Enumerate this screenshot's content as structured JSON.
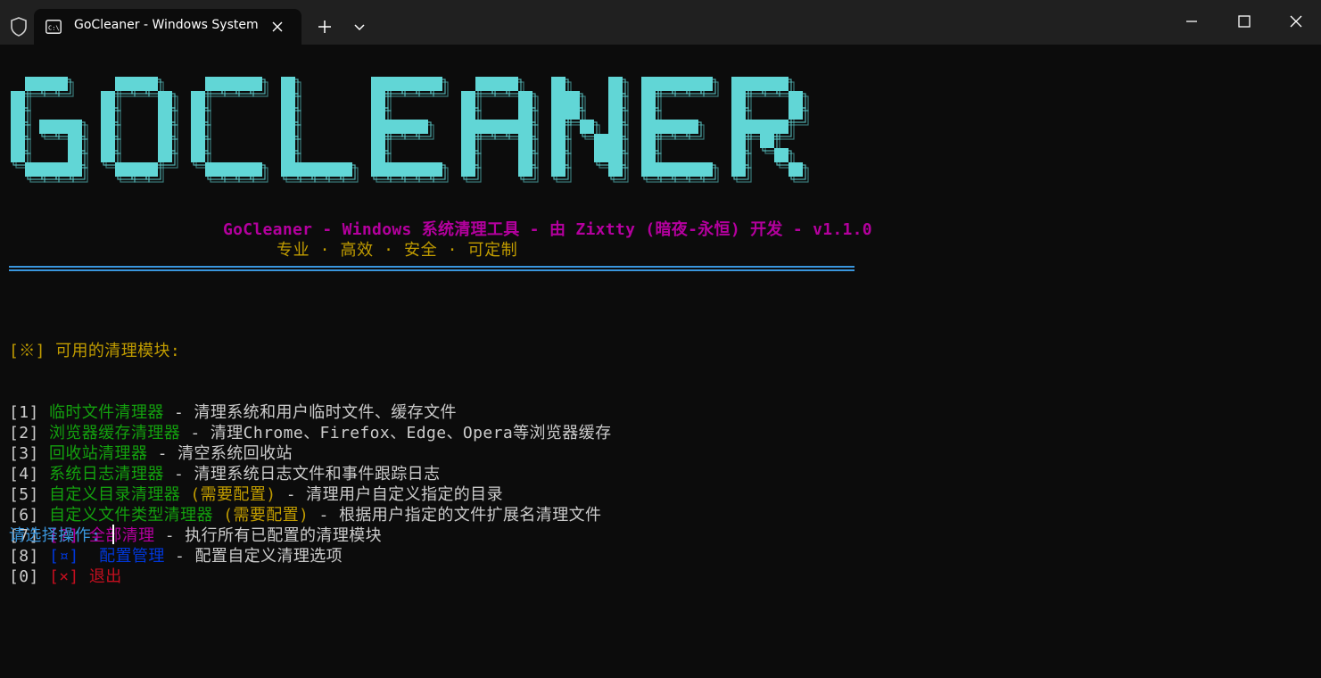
{
  "window": {
    "tab_title": "GoCleaner - Windows System"
  },
  "banner": {
    "text": "GOCLEANER",
    "color_main": "#61d6d6",
    "color_outline": "#61d6d6"
  },
  "header": {
    "subtitle": "GoCleaner - Windows 系统清理工具 - 由 Zixtty (暗夜-永恒) 开发 - v1.1.0",
    "slogan": "专业 · 高效 · 安全 · 可定制"
  },
  "menu": {
    "title": "[※] 可用的清理模块:",
    "items": [
      {
        "key": "[1] ",
        "name": "临时文件清理器",
        "extra": "",
        "desc": " - 清理系统和用户临时文件、缓存文件"
      },
      {
        "key": "[2] ",
        "name": "浏览器缓存清理器",
        "extra": "",
        "desc": " - 清理Chrome、Firefox、Edge、Opera等浏览器缓存"
      },
      {
        "key": "[3] ",
        "name": "回收站清理器",
        "extra": "",
        "desc": " - 清空系统回收站"
      },
      {
        "key": "[4] ",
        "name": "系统日志清理器",
        "extra": "",
        "desc": " - 清理系统日志文件和事件跟踪日志"
      },
      {
        "key": "[5] ",
        "name": "自定义目录清理器 ",
        "extra": "(需要配置)",
        "desc": " - 清理用户自定义指定的目录"
      },
      {
        "key": "[6] ",
        "name": "自定义文件类型清理器 ",
        "extra": "(需要配置)",
        "desc": " - 根据用户指定的文件扩展名清理文件"
      },
      {
        "key": "[7] ",
        "name": "[?] 全部清理",
        "extra": "",
        "desc": " - 执行所有已配置的清理模块"
      },
      {
        "key": "[8] ",
        "name": "[¤]  配置管理",
        "extra": "",
        "desc": " - 配置自定义清理选项"
      },
      {
        "key": "[0] ",
        "name": "[×] 退出",
        "extra": "",
        "desc": ""
      }
    ]
  },
  "prompt": {
    "text": "请选择操作: "
  },
  "colors": {
    "background": "#0c0c0c",
    "titlebar": "#202020",
    "yellow": "#c19c00",
    "green": "#13a10e",
    "magenta": "#b4009e",
    "blue": "#0037da",
    "red": "#c50f1f",
    "cyan": "#3a96dd",
    "banner": "#61d6d6"
  }
}
